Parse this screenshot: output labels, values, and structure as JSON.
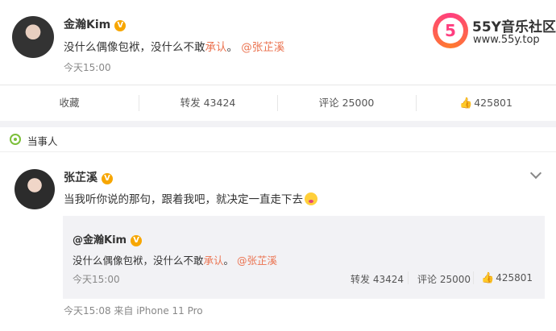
{
  "post1": {
    "author": "金瀚Kim",
    "verified": "V",
    "text_prefix": "没什么偶像包袱，没什么不敢",
    "text_highlight": "承认",
    "text_suffix": "。",
    "mention": "@张芷溪",
    "time": "今天15:00",
    "actions": {
      "collect": "收藏",
      "repost": "转发 43424",
      "comment": "评论 25000",
      "like": "425801"
    }
  },
  "watermark": {
    "logo_glyph": "5",
    "title": "55Y音乐社区",
    "url": "www.55y.top"
  },
  "section": {
    "label": "当事人"
  },
  "post2": {
    "author": "张芷溪",
    "verified": "V",
    "text": "当我听你说的那句，跟着我吧，就决定一直走下去",
    "time_source": "今天15:08  来自 iPhone 11 Pro",
    "repost": {
      "author": "@金瀚Kim",
      "verified": "V",
      "text_prefix": "没什么偶像包袱，没什么不敢",
      "text_highlight": "承认",
      "text_suffix": "。",
      "mention": "@张芷溪",
      "time": "今天15:00",
      "repost_count": "转发 43424",
      "comment_count": "评论 25000",
      "like_count": "425801"
    }
  },
  "icons": {
    "like": "thumbs-up-icon",
    "section": "location-pin-icon",
    "menu": "chevron-down-icon"
  }
}
